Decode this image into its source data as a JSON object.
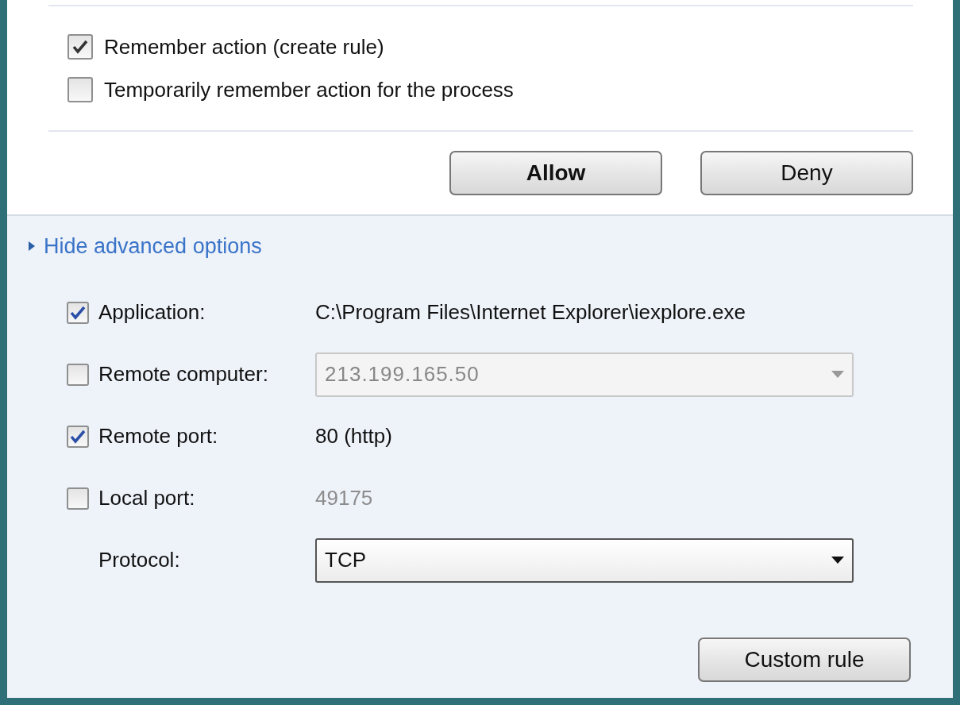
{
  "options": [
    {
      "label": "Remember action (create rule)",
      "checked": true
    },
    {
      "label": "Temporarily remember action for the process",
      "checked": false
    }
  ],
  "buttons": [
    {
      "label": "Allow",
      "default": true
    },
    {
      "label": "Deny",
      "default": false
    }
  ],
  "advanced_toggle": {
    "label": "Hide advanced options"
  },
  "fields": [
    {
      "kind": "text",
      "label": "Application:",
      "checked": true,
      "value": "C:\\Program Files\\Internet Explorer\\iexplore.exe"
    },
    {
      "kind": "select",
      "label": "Remote computer:",
      "checked": false,
      "value": "213.199.165.50"
    },
    {
      "kind": "text",
      "label": "Remote port:",
      "checked": true,
      "value": "80 (http)"
    },
    {
      "kind": "text",
      "label": "Local port:",
      "checked": false,
      "value": "49175"
    },
    {
      "kind": "select",
      "label": "Protocol:",
      "value": "TCP"
    }
  ],
  "custom_button": {
    "label": "Custom rule"
  }
}
